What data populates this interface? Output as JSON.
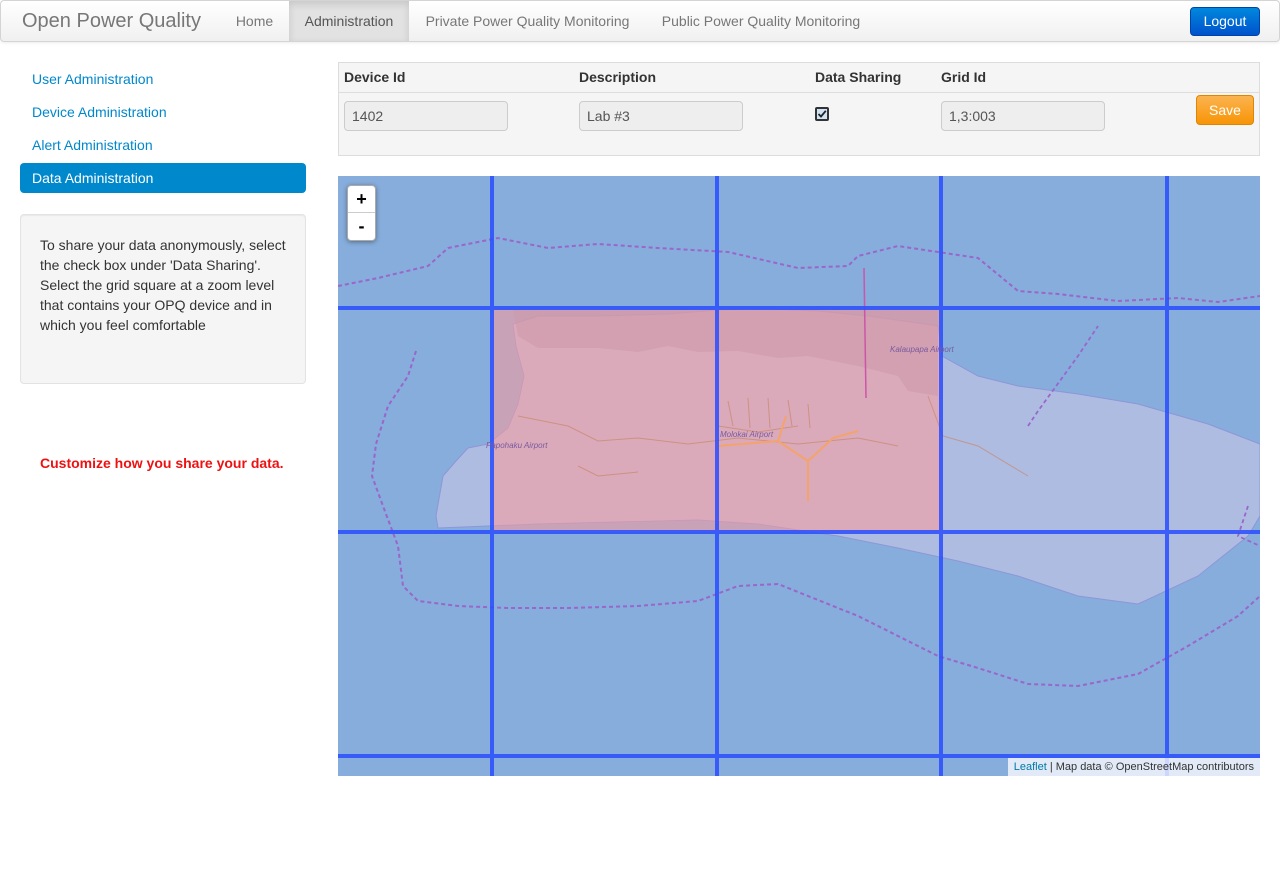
{
  "navbar": {
    "brand": "Open Power Quality",
    "links": [
      {
        "label": "Home"
      },
      {
        "label": "Administration"
      },
      {
        "label": "Private Power Quality Monitoring"
      },
      {
        "label": "Public Power Quality Monitoring"
      }
    ],
    "active_link": "Administration",
    "logout_label": "Logout"
  },
  "sidebar": {
    "items": [
      {
        "label": "User Administration"
      },
      {
        "label": "Device Administration"
      },
      {
        "label": "Alert Administration"
      },
      {
        "label": "Data Administration"
      }
    ],
    "active_item": "Data Administration",
    "help_text": "To share your data anonymously, select the check box under 'Data Sharing'. Select the grid square at a zoom level that contains your OPQ device and in which you feel comfortable",
    "customize_text": "Customize how you share your data."
  },
  "device_table": {
    "headers": [
      "Device Id",
      "Description",
      "Data Sharing",
      "Grid Id"
    ],
    "row": {
      "device_id": "1402",
      "description": "Lab #3",
      "data_sharing": true,
      "grid_id": "1,3:003",
      "save_label": "Save"
    }
  },
  "map": {
    "zoom_in_label": "+",
    "zoom_out_label": "-",
    "attribution_link": "Leaflet",
    "attribution_text": " | Map data © OpenStreetMap contributors",
    "place_labels": [
      "Kalaupapa Airport",
      "Molokai Airport",
      "Papohaku Airport"
    ],
    "colors": {
      "sea": "#aad3df",
      "grid_line": "#2a4dff",
      "grid_overlay": "#5a7fd6",
      "selected_cell": "#ff9999",
      "boundary": "#9966cc"
    }
  }
}
